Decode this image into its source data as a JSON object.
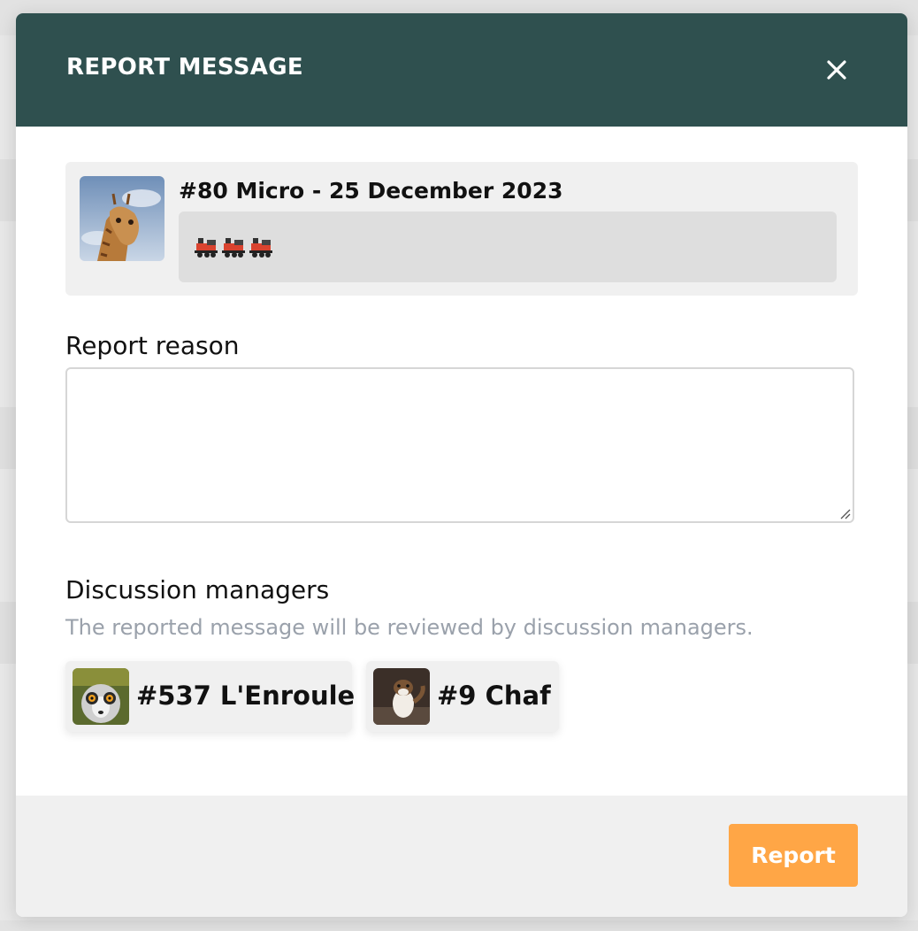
{
  "modal": {
    "title": "REPORT MESSAGE",
    "close_icon": "close-icon"
  },
  "message": {
    "title": "#80 Micro - 25 December 2023",
    "avatar_icon": "giraffe-avatar",
    "body_emojis": [
      "train-icon",
      "train-icon",
      "train-icon"
    ]
  },
  "report_reason": {
    "label": "Report reason",
    "value": ""
  },
  "managers": {
    "label": "Discussion managers",
    "help": "The reported message will be reviewed by discussion managers.",
    "items": [
      {
        "name": "#537 L'Enroule",
        "avatar_icon": "lemur-avatar"
      },
      {
        "name": "#9 Chaf",
        "avatar_icon": "stoat-avatar"
      }
    ]
  },
  "footer": {
    "report_label": "Report"
  },
  "colors": {
    "header_bg": "#2f504f",
    "report_button": "#ffa646",
    "help_text": "#9aa1ab"
  }
}
